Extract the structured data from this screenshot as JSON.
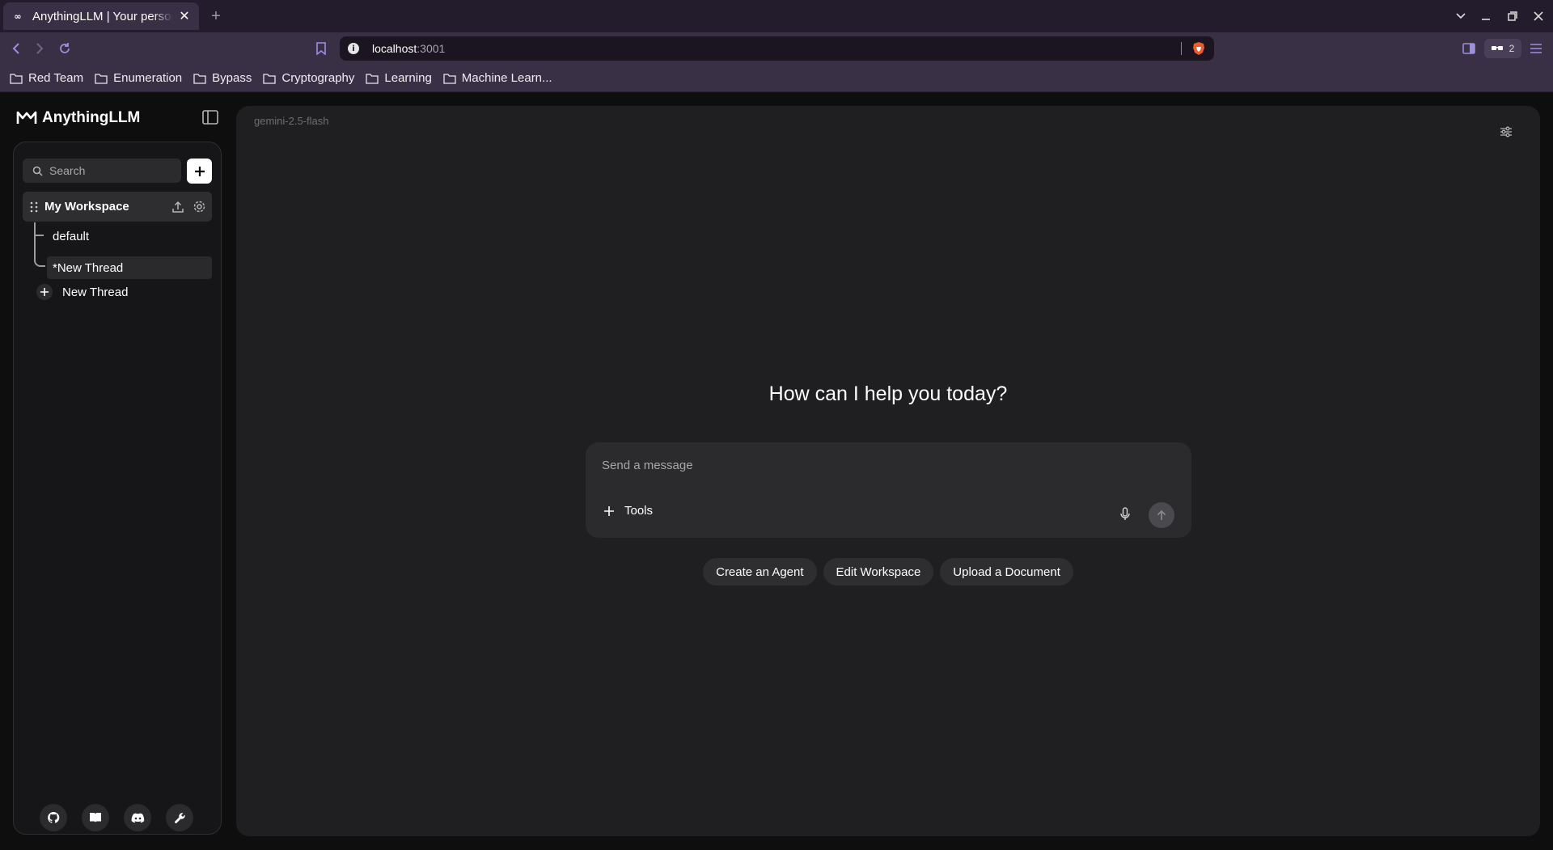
{
  "browser": {
    "tab_title": "AnythingLLM | Your personal LLM",
    "tab_favicon": "∞",
    "url_host": "localhost",
    "url_port": ":3001",
    "wallet_count": "2",
    "bookmarks": [
      {
        "label": "Red Team"
      },
      {
        "label": "Enumeration"
      },
      {
        "label": "Bypass"
      },
      {
        "label": "Cryptography"
      },
      {
        "label": "Learning"
      },
      {
        "label": "Machine Learn..."
      }
    ]
  },
  "app": {
    "brand": "AnythingLLM",
    "search_placeholder": "Search",
    "workspace": {
      "name": "My Workspace",
      "threads": [
        {
          "label": "default",
          "active": false
        },
        {
          "label": "*New Thread",
          "active": true
        }
      ],
      "new_thread_label": "New Thread"
    },
    "footer_icons": [
      "github-icon",
      "docs-book-icon",
      "discord-icon",
      "wrench-icon"
    ]
  },
  "main": {
    "model_name": "gemini-2.5-flash",
    "greeting": "How can I help you today?",
    "message_placeholder": "Send a message",
    "tools_label": "Tools",
    "suggestions": [
      "Create an Agent",
      "Edit Workspace",
      "Upload a Document"
    ]
  },
  "colors": {
    "browser_chrome": "#3a3046",
    "tabstrip": "#221c2c",
    "sidebar_bg": "#161618",
    "main_bg": "#1f1f21",
    "input_bg": "#2b2b2e"
  }
}
